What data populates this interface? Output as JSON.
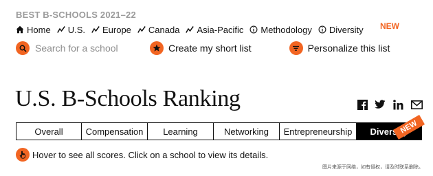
{
  "kicker": "BEST B-SCHOOLS 2021–22",
  "nav": {
    "items": [
      {
        "label": "Home",
        "icon": "home-icon"
      },
      {
        "label": "U.S.",
        "icon": "trend-icon"
      },
      {
        "label": "Europe",
        "icon": "trend-icon"
      },
      {
        "label": "Canada",
        "icon": "trend-icon"
      },
      {
        "label": "Asia-Pacific",
        "icon": "trend-icon"
      },
      {
        "label": "Methodology",
        "icon": "info-icon"
      },
      {
        "label": "Diversity",
        "icon": "info-icon"
      }
    ],
    "new_badge": "NEW"
  },
  "actions": {
    "search_placeholder": "Search for a school",
    "shortlist_label": "Create my short list",
    "personalize_label": "Personalize this list"
  },
  "page_title": "U.S. B-Schools Ranking",
  "share_icons": [
    "facebook-icon",
    "twitter-icon",
    "linkedin-icon",
    "email-icon"
  ],
  "tabs": [
    {
      "label": "Overall",
      "active": false
    },
    {
      "label": "Compensation",
      "active": false
    },
    {
      "label": "Learning",
      "active": false
    },
    {
      "label": "Networking",
      "active": false
    },
    {
      "label": "Entrepreneurship",
      "active": false
    },
    {
      "label": "Diversity",
      "active": true
    }
  ],
  "tab_new_ribbon": "NEW",
  "hint": "Hover to see all scores. Click on a school to view its details.",
  "watermark": "图片来源于网络，如有侵权，请及时联系删除。",
  "colors": {
    "accent": "#f26522",
    "text": "#111111",
    "muted": "#9b9b9b"
  }
}
